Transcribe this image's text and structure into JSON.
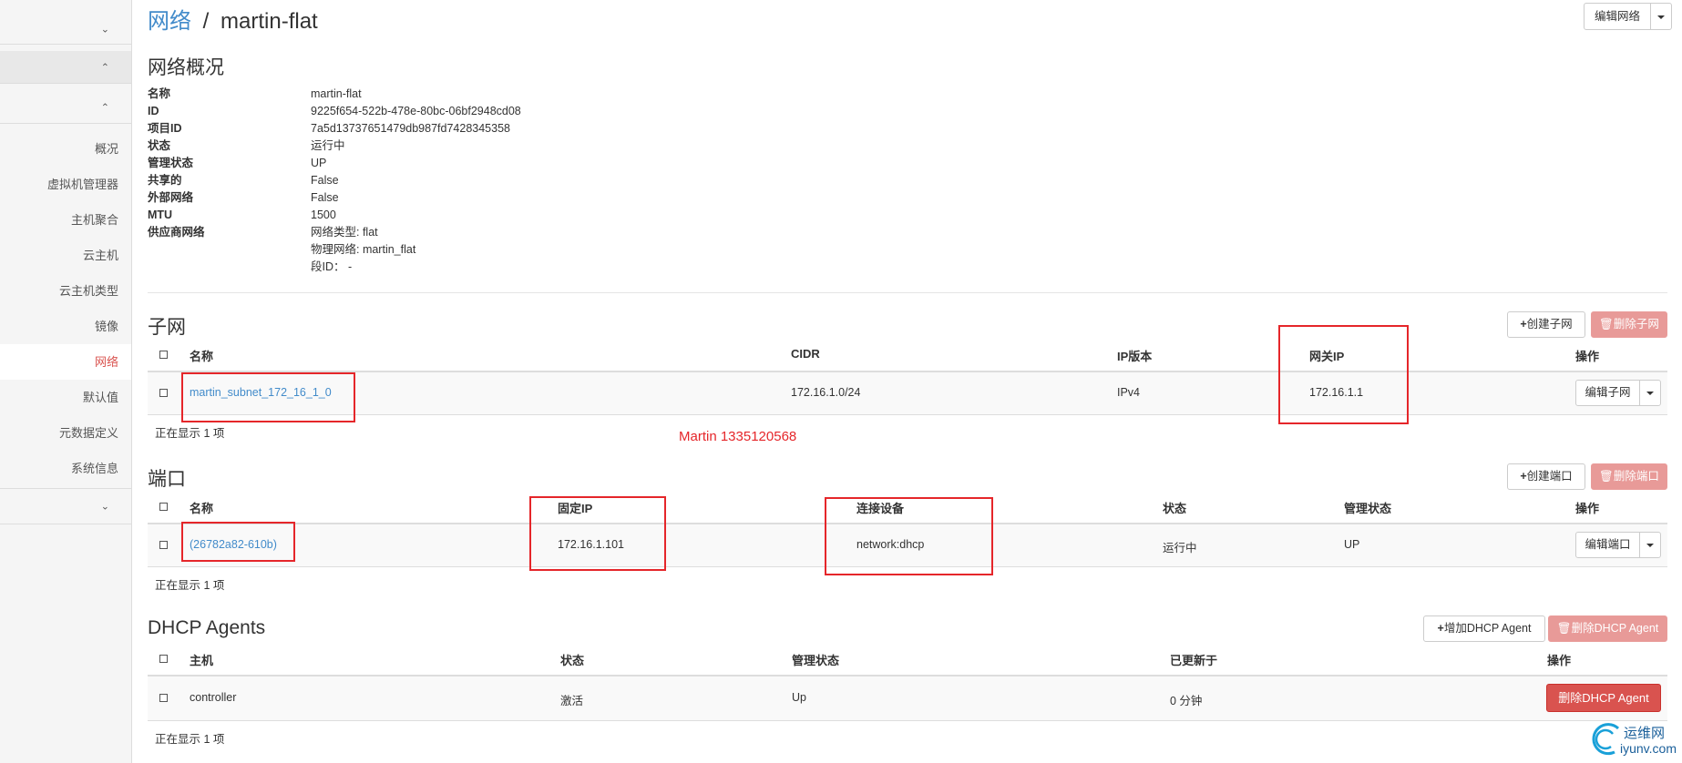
{
  "breadcrumb": {
    "parent": "网络",
    "separator": "/",
    "current": "martin-flat"
  },
  "header_action": {
    "label": "编辑网络"
  },
  "sidebar": {
    "items": [
      {
        "label": "概况"
      },
      {
        "label": "虚拟机管理器"
      },
      {
        "label": "主机聚合"
      },
      {
        "label": "云主机"
      },
      {
        "label": "云主机类型"
      },
      {
        "label": "镜像"
      },
      {
        "label": "网络",
        "active": true
      },
      {
        "label": "默认值"
      },
      {
        "label": "元数据定义"
      },
      {
        "label": "系统信息"
      }
    ]
  },
  "overview": {
    "title": "网络概况",
    "rows": [
      {
        "key": "名称",
        "value": "martin-flat"
      },
      {
        "key": "ID",
        "value": "9225f654-522b-478e-80bc-06bf2948cd08"
      },
      {
        "key": "项目ID",
        "value": "7a5d13737651479db987fd7428345358"
      },
      {
        "key": "状态",
        "value": "运行中"
      },
      {
        "key": "管理状态",
        "value": "UP"
      },
      {
        "key": "共享的",
        "value": "False"
      },
      {
        "key": "外部网络",
        "value": "False"
      },
      {
        "key": "MTU",
        "value": "1500"
      },
      {
        "key": "供应商网络",
        "value": "网络类型: flat"
      }
    ],
    "provider_extra": [
      "物理网络: martin_flat",
      "段ID： -"
    ]
  },
  "subnets": {
    "title": "子网",
    "create_label": "创建子网",
    "delete_label": "删除子网",
    "columns": [
      "名称",
      "CIDR",
      "IP版本",
      "网关IP",
      "操作"
    ],
    "rows": [
      {
        "name": "martin_subnet_172_16_1_0",
        "cidr": "172.16.1.0/24",
        "ip_version": "IPv4",
        "gateway": "172.16.1.1",
        "action": "编辑子网"
      }
    ],
    "count": "正在显示 1 项"
  },
  "watermark_text": "Martin 1335120568",
  "ports": {
    "title": "端口",
    "create_label": "创建端口",
    "delete_label": "删除端口",
    "columns": [
      "名称",
      "固定IP",
      "连接设备",
      "状态",
      "管理状态",
      "操作"
    ],
    "rows": [
      {
        "name": "(26782a82-610b)",
        "fixed_ip": "172.16.1.101",
        "device": "network:dhcp",
        "status": "运行中",
        "admin_state": "UP",
        "action": "编辑端口"
      }
    ],
    "count": "正在显示 1 项"
  },
  "dhcp": {
    "title": "DHCP Agents",
    "add_label": "增加DHCP Agent",
    "delete_label": "删除DHCP Agent",
    "columns": [
      "主机",
      "状态",
      "管理状态",
      "已更新于",
      "操作"
    ],
    "rows": [
      {
        "host": "controller",
        "status": "激活",
        "admin_state": "Up",
        "updated": "0 分钟",
        "action": "删除DHCP Agent"
      }
    ],
    "count": "正在显示 1 项"
  },
  "logo": {
    "text_cn": "运维网",
    "text_en": "iyunv.com"
  },
  "colors": {
    "link": "#428bca",
    "danger": "#d9534f",
    "highlight": "#e5262a"
  }
}
